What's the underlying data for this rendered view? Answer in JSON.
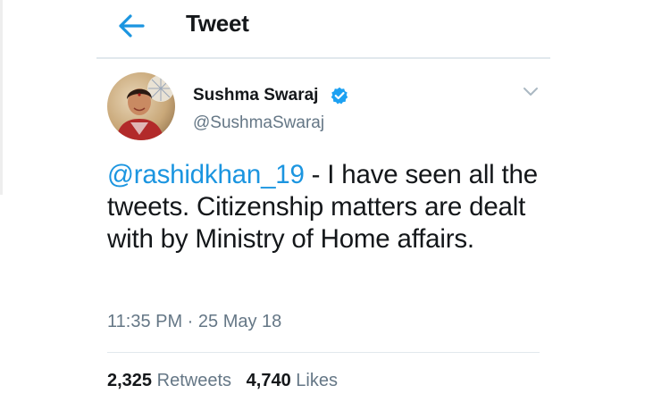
{
  "header": {
    "title": "Tweet",
    "back_icon": "arrow-left-icon"
  },
  "tweet": {
    "author_name": "Sushma Swaraj",
    "author_handle": "@SushmaSwaraj",
    "verified_icon": "verified-badge-icon",
    "menu_icon": "chevron-down-icon",
    "mention": "@rashidkhan_19",
    "text": " - I have seen all the tweets. Citizenship matters are dealt with by Ministry of Home affairs.",
    "timestamp": "11:35 PM · 25 May 18",
    "retweets_count": "2,325",
    "retweets_label": "Retweets",
    "likes_count": "4,740",
    "likes_label": "Likes"
  },
  "colors": {
    "accent": "#1b95e0",
    "text": "#14171a",
    "muted": "#657786",
    "border": "#e1e8ed",
    "verified": "#1da1f2"
  }
}
